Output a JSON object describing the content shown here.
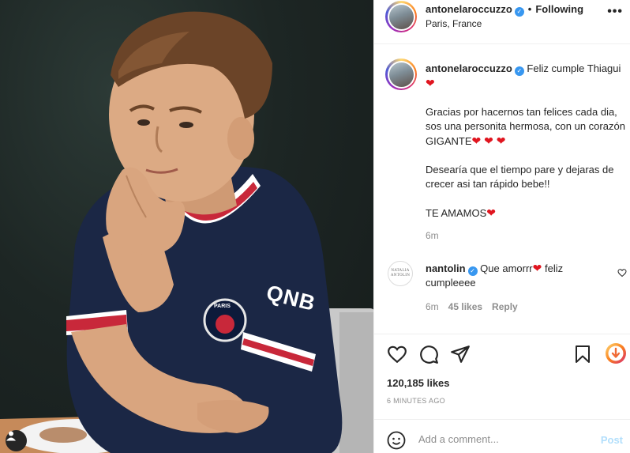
{
  "post": {
    "author": "antonelaroccuzzo",
    "follow_sep": "•",
    "follow_status": "Following",
    "location": "Paris, France",
    "more_label": "•••"
  },
  "caption": {
    "author": "antonelaroccuzzo",
    "line1": "Feliz cumple Thiagui",
    "para2": "Gracias por hacernos tan felices cada dia, sos una personita hermosa, con un corazón GIGANTE",
    "para3": "Desearía que el tiempo pare y dejaras de crecer asi tan rápido bebe!!",
    "para4": "TE AMAMOS",
    "time": "6m"
  },
  "reply": {
    "avatar_text": "NATALIA ANTOLIN",
    "author": "nantolin",
    "text": "Que amorrr",
    "text2": "feliz cumpleeee",
    "time": "6m",
    "likes": "45 likes",
    "reply_label": "Reply"
  },
  "photo": {
    "chest_sponsor": "QNB",
    "crest_text": "PARIS"
  },
  "stats": {
    "likes": "120,185 likes",
    "posted_ago": "6 MINUTES AGO"
  },
  "comment_box": {
    "placeholder": "Add a comment...",
    "post_label": "Post"
  },
  "icons": {
    "heart": "heart-icon",
    "comment": "comment-icon",
    "share": "share-icon",
    "save": "bookmark-icon",
    "download": "download-icon",
    "emoji": "emoji-icon",
    "user_tag": "user-tag-icon",
    "verified": "verified-badge-icon"
  },
  "colors": {
    "accent_blue": "#3897f0",
    "post_disabled": "#b2dffc",
    "heart_red": "#e0151f",
    "muted": "#8e8e8e"
  }
}
